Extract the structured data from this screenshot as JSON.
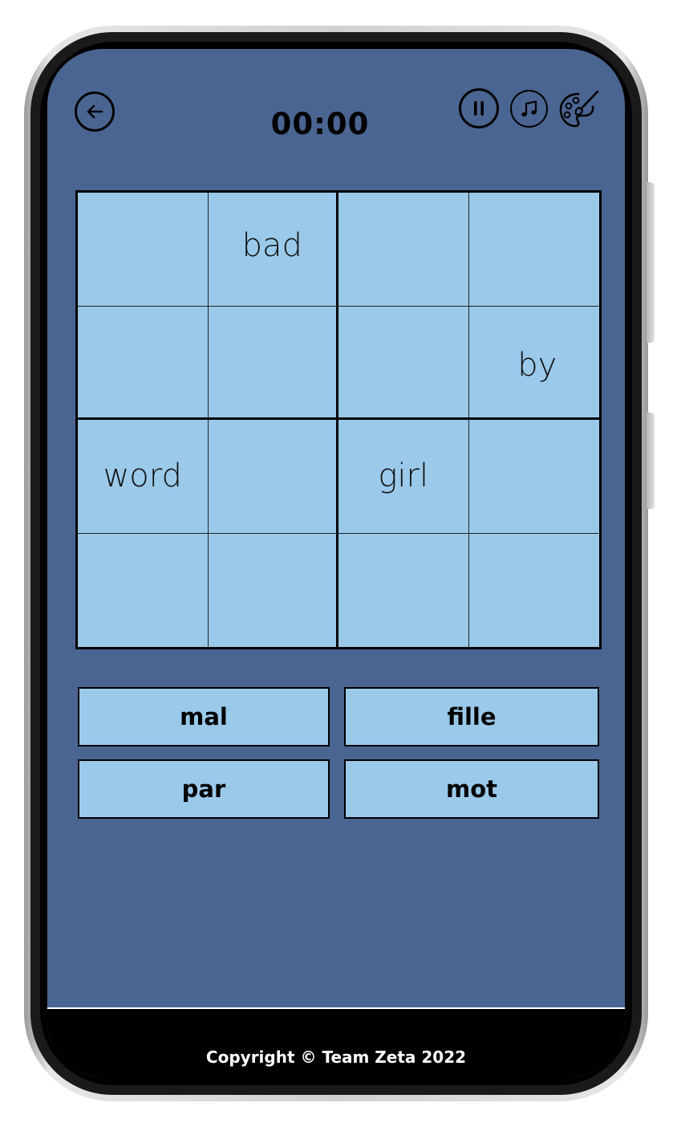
{
  "header": {
    "back_icon": "arrow-left-icon",
    "timer": "00:00",
    "pause_icon": "pause-icon",
    "music_icon": "music-note-icon",
    "theme_icon": "palette-brush-icon"
  },
  "grid": {
    "cells": [
      [
        "",
        "bad",
        "",
        ""
      ],
      [
        "",
        "",
        "",
        "by"
      ],
      [
        "word",
        "",
        "girl",
        ""
      ],
      [
        "",
        "",
        "",
        ""
      ]
    ]
  },
  "answers": [
    "mal",
    "fille",
    "par",
    "mot"
  ],
  "footer": {
    "copyright": "Copyright © Team Zeta 2022"
  },
  "colors": {
    "background": "#4b6592",
    "cell": "#9ac9ea",
    "footer": "#000000"
  }
}
